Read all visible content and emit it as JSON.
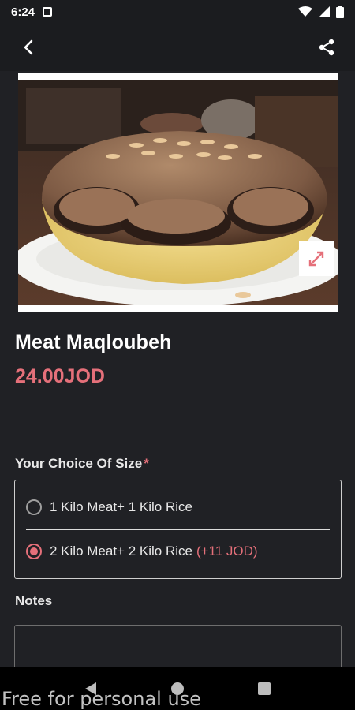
{
  "status_bar": {
    "time": "6:24",
    "icons": [
      "notification-icon",
      "wifi-icon",
      "signal-icon",
      "battery-icon"
    ]
  },
  "app_bar": {
    "back_icon": "back-arrow-icon",
    "share_icon": "share-icon"
  },
  "product": {
    "title": "Meat Maqloubeh",
    "price": "24.00JOD",
    "image_alt": "Meat Maqloubeh dish"
  },
  "size_section": {
    "label": "Your Choice Of Size",
    "required_mark": "*",
    "options": [
      {
        "label": "1 Kilo Meat+ 1 Kilo Rice",
        "extra": "",
        "selected": false
      },
      {
        "label": "2 Kilo Meat+ 2 Kilo Rice",
        "extra": "(+11 JOD)",
        "selected": true
      }
    ]
  },
  "notes_section": {
    "label": "Notes",
    "value": ""
  },
  "watermark": "Free for personal use",
  "colors": {
    "background": "#202125",
    "accent": "#e5707a",
    "text": "#ffffff"
  }
}
